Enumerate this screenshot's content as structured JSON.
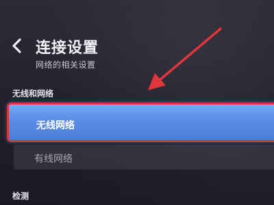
{
  "header": {
    "title": "连接设置",
    "subtitle": "网络的相关设置"
  },
  "sections": {
    "wireless_network_heading": "无线和网络",
    "detect_heading": "检测"
  },
  "items": {
    "wireless": "无线网络",
    "wired": "有线网络"
  },
  "colors": {
    "accent_blue": "#5b8ee6",
    "highlight_red": "#e0303c",
    "background": "#26252f"
  },
  "icons": {
    "back": "chevron-left-icon",
    "annotation": "red-arrow"
  }
}
